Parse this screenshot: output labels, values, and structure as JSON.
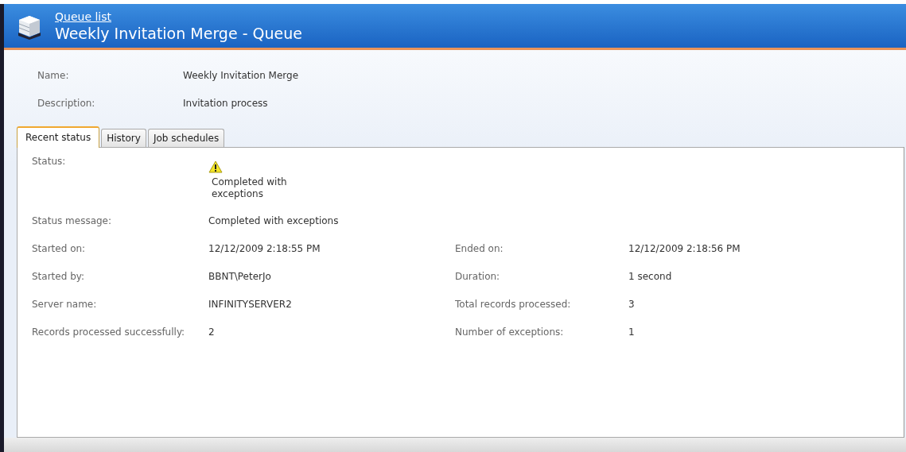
{
  "header": {
    "link": "Queue list",
    "title": "Weekly Invitation Merge - Queue"
  },
  "fields": [
    {
      "label": "Name:",
      "value": "Weekly Invitation Merge"
    },
    {
      "label": "Description:",
      "value": "Invitation process"
    }
  ],
  "tabs": [
    {
      "label": "Recent status",
      "selected": true
    },
    {
      "label": "History",
      "selected": false
    },
    {
      "label": "Job schedules",
      "selected": false
    }
  ],
  "status": {
    "label": "Status:",
    "kind": "warning",
    "text": "Completed with exceptions"
  },
  "status_message": {
    "label": "Status message:",
    "value": "Completed with exceptions"
  },
  "details": [
    {
      "left": {
        "label": "Started on:",
        "value": "12/12/2009 2:18:55 PM"
      },
      "right": {
        "label": "Ended on:",
        "value": "12/12/2009 2:18:56 PM"
      }
    },
    {
      "left": {
        "label": "Started by:",
        "value": "BBNT\\PeterJo"
      },
      "right": {
        "label": "Duration:",
        "value": "1 second"
      }
    },
    {
      "left": {
        "label": "Server name:",
        "value": "INFINITYSERVER2"
      },
      "right": {
        "label": "Total records processed:",
        "value": "3"
      }
    },
    {
      "left": {
        "label": "Records processed successfully:",
        "value": "2"
      },
      "right": {
        "label": "Number of exceptions:",
        "value": "1"
      }
    }
  ]
}
